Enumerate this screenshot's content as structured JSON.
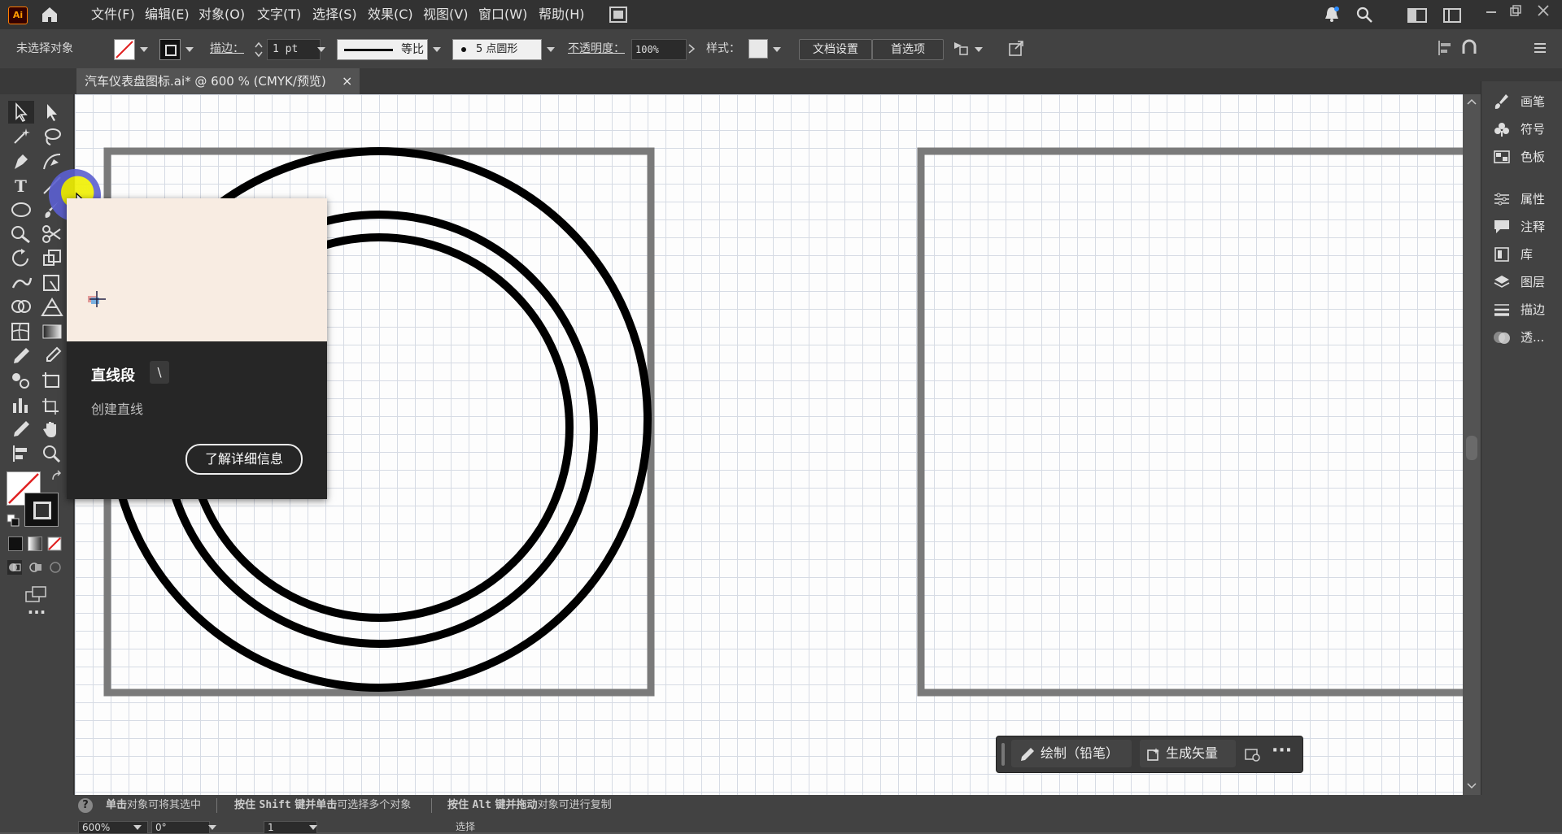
{
  "app": {
    "logo": "Ai"
  },
  "menu": [
    "文件(F)",
    "编辑(E)",
    "对象(O)",
    "文字(T)",
    "选择(S)",
    "效果(C)",
    "视图(V)",
    "窗口(W)",
    "帮助(H)"
  ],
  "control": {
    "selection": "未选择对象",
    "stroke_label": "描边：",
    "stroke_value": "1 pt",
    "profile": "等比",
    "brush": "5 点圆形",
    "opacity_label": "不透明度：",
    "opacity_value": "100%",
    "style_label": "样式：",
    "doc_setup": "文档设置",
    "prefs": "首选项"
  },
  "tab": {
    "title": "汽车仪表盘图标.ai* @ 600 % (CMYK/预览)",
    "close": "×"
  },
  "panels": [
    {
      "label": "画笔",
      "icon": "brush-icon"
    },
    {
      "label": "符号",
      "icon": "symbol-icon"
    },
    {
      "label": "色板",
      "icon": "swatches-icon"
    },
    {
      "label": "属性",
      "icon": "properties-icon"
    },
    {
      "label": "注释",
      "icon": "comment-icon"
    },
    {
      "label": "库",
      "icon": "library-icon"
    },
    {
      "label": "图层",
      "icon": "layers-icon"
    },
    {
      "label": "描边",
      "icon": "stroke-icon"
    },
    {
      "label": "透...",
      "icon": "transparency-icon"
    }
  ],
  "tooltip": {
    "title": "直线段",
    "shortcut": "\\",
    "desc": "创建直线",
    "link": "了解详细信息"
  },
  "ctxbar": {
    "draw": "绘制（铅笔）",
    "vector": "生成矢量"
  },
  "status": {
    "hint1_b": "单击",
    "hint1": "对象可将其选中",
    "hint2_a": "按住 ",
    "hint2_b": "Shift",
    "hint2_c": " 键并",
    "hint2_d": "单击",
    "hint2_e": "可选择多个对象",
    "hint3_a": "按住 ",
    "hint3_b": "Alt",
    "hint3_c": " 键并",
    "hint3_d": "拖动",
    "hint3_e": "对象可进行复制",
    "zoom": "600%",
    "angle": "0°",
    "page": "1",
    "mode": "选择"
  },
  "colors": {
    "accent": "#ff9a00",
    "canvas": "#fdfdfd",
    "artboard_frame": "#7a7a7a"
  }
}
